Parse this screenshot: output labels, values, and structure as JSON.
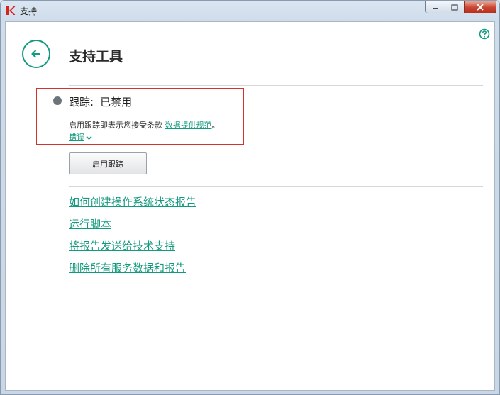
{
  "window": {
    "title": "支持"
  },
  "page": {
    "title": "支持工具"
  },
  "trace": {
    "label": "跟踪:",
    "status": "已禁用",
    "note_prefix": "启用跟踪即表示您接受条款",
    "note_link": "数据提供规范",
    "note_suffix": "。",
    "errors_link": "错误",
    "enable_button": "启用跟踪"
  },
  "links": [
    {
      "label": "如何创建操作系统状态报告"
    },
    {
      "label": "运行脚本"
    },
    {
      "label": "将报告发送给技术支持"
    },
    {
      "label": "删除所有服务数据和报告"
    }
  ],
  "colors": {
    "accent": "#139a7f",
    "highlight_border": "#d0342c",
    "status_dot": "#6b737b"
  },
  "icons": {
    "app": "kaspersky-k-icon",
    "help": "question-circle-icon",
    "back": "arrow-left-icon",
    "errors": "chevron-down-icon"
  }
}
